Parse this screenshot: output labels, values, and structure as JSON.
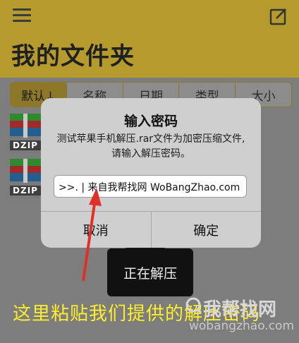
{
  "header": {
    "title": "我的文件夹"
  },
  "sort_tabs": [
    {
      "label": "默认↓",
      "active": true
    },
    {
      "label": "名称",
      "active": false
    },
    {
      "label": "日期",
      "active": false
    },
    {
      "label": "类型",
      "active": false
    },
    {
      "label": "大小",
      "active": false
    }
  ],
  "files": [
    {
      "type_label": "DZIP"
    },
    {
      "type_label": "DZIP"
    }
  ],
  "dialog": {
    "title": "输入密码",
    "message": "测试苹果手机解压.rar文件为加密压缩文件,请输入解压密码。",
    "input_value": ">>. | 来自我帮找网 WoBangZhao.com",
    "cancel_label": "取消",
    "confirm_label": "确定"
  },
  "toast": {
    "label": "正在解压"
  },
  "annotation": {
    "text": "这里粘贴我们提供的解压密码"
  },
  "watermark": {
    "logo_text": "我帮找网",
    "url": "wobangzhao.com"
  },
  "colors": {
    "header_bg": "#b59a2e",
    "annotation": "#ffef2a",
    "arrow": "#e0302a"
  }
}
